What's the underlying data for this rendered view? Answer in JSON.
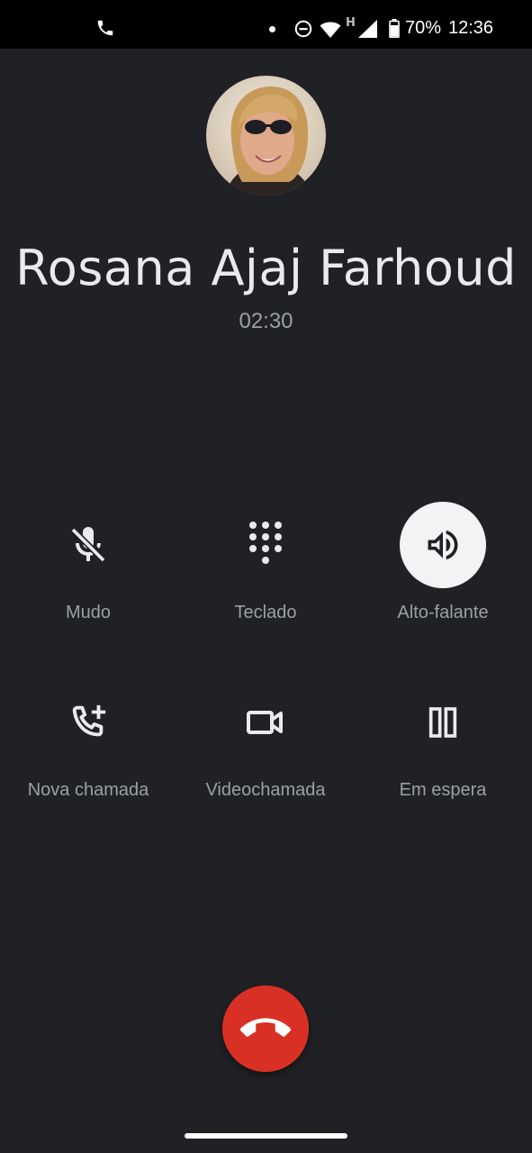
{
  "status_bar": {
    "battery_percent": "70%",
    "time": "12:36",
    "network_type": "H",
    "icons": [
      "phone-call-icon",
      "notification-dot-icon",
      "do-not-disturb-icon",
      "wifi-icon",
      "cell-signal-icon",
      "battery-icon"
    ]
  },
  "contact": {
    "name": "Rosana Ajaj Farhoud",
    "call_duration": "02:30"
  },
  "controls": {
    "mute": {
      "label": "Mudo",
      "icon": "mic-off-icon",
      "active": false
    },
    "keypad": {
      "label": "Teclado",
      "icon": "dialpad-icon",
      "active": false
    },
    "speaker": {
      "label": "Alto-falante",
      "icon": "speaker-icon",
      "active": true
    },
    "add_call": {
      "label": "Nova chamada",
      "icon": "add-call-icon",
      "active": false
    },
    "video_call": {
      "label": "Videochamada",
      "icon": "video-camera-icon",
      "active": false
    },
    "hold": {
      "label": "Em espera",
      "icon": "pause-icon",
      "active": false
    }
  },
  "end_call": {
    "icon": "end-call-icon",
    "color": "#d93025"
  },
  "colors": {
    "background": "#202124",
    "label": "#9aa0a6",
    "active_button": "#f1f3f4",
    "end_call": "#d93025"
  }
}
